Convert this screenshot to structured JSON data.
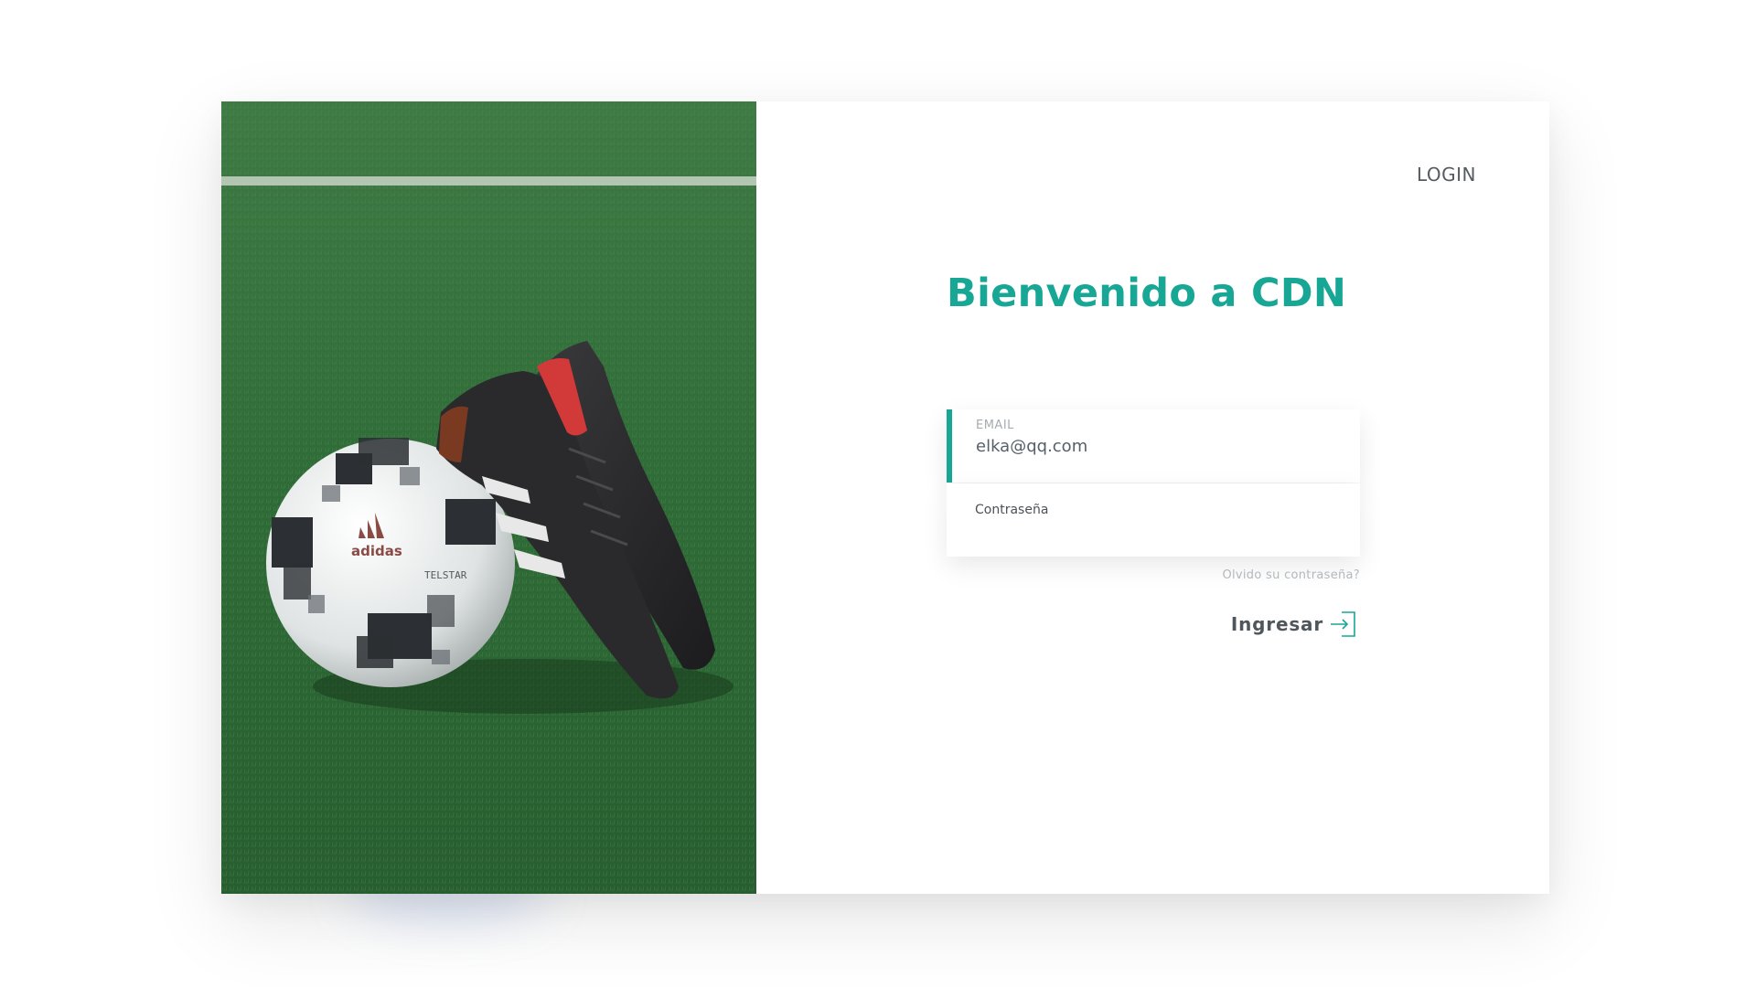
{
  "nav": {
    "login_label": "LOGIN"
  },
  "form": {
    "title": "Bienvenido a CDN",
    "email_label": "EMAIL",
    "email_value": "elka@qq.com",
    "password_label": "Contraseña",
    "password_value": "",
    "forgot_label": "Olvido su contraseña?",
    "submit_label": "Ingresar"
  },
  "photo": {
    "ball_brand_text": "adidas",
    "ball_model_text": "TELSTAR",
    "icon": "football-boots-and-ball-photo"
  },
  "icons": {
    "submit": "login-arrow-icon"
  },
  "colors": {
    "accent": "#17a794",
    "grass": "#2f6a35",
    "text": "#50575c",
    "muted": "#b3b8bc"
  }
}
